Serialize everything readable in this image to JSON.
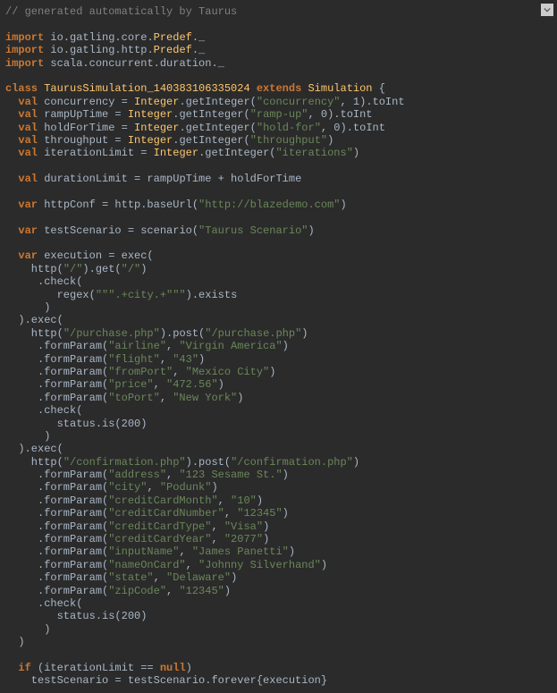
{
  "comment": "// generated automatically by Taurus",
  "kw": {
    "import": "import",
    "class": "class",
    "extends": "extends",
    "val": "val",
    "var": "var",
    "if": "if",
    "null": "null"
  },
  "imports": {
    "l1a": " io.gatling.core.",
    "l1b": "Predef",
    "l1c": "._",
    "l2a": " io.gatling.http.",
    "l2b": "Predef",
    "l2c": "._",
    "l3a": " scala.concurrent.duration._"
  },
  "classDecl": {
    "name": "TaurusSimulation_140383106335024",
    "base": "Simulation",
    "brace": " {"
  },
  "vals": {
    "concurrency_a": " concurrency = ",
    "concurrency_b": "Integer",
    "concurrency_c": ".getInteger(",
    "concurrency_d": "\"concurrency\"",
    "concurrency_e": ", 1).toInt",
    "rampUp_a": " rampUpTime = ",
    "rampUp_b": "Integer",
    "rampUp_c": ".getInteger(",
    "rampUp_d": "\"ramp-up\"",
    "rampUp_e": ", 0).toInt",
    "hold_a": " holdForTime = ",
    "hold_b": "Integer",
    "hold_c": ".getInteger(",
    "hold_d": "\"hold-for\"",
    "hold_e": ", 0).toInt",
    "thr_a": " throughput = ",
    "thr_b": "Integer",
    "thr_c": ".getInteger(",
    "thr_d": "\"throughput\"",
    "thr_e": ")",
    "iter_a": " iterationLimit = ",
    "iter_b": "Integer",
    "iter_c": ".getInteger(",
    "iter_d": "\"iterations\"",
    "iter_e": ")",
    "dur": " durationLimit = rampUpTime + holdForTime"
  },
  "httpConf": {
    "a": " httpConf = http.baseUrl(",
    "b": "\"http://blazedemo.com\"",
    "c": ")"
  },
  "scenario": {
    "a": " testScenario = scenario(",
    "b": "\"Taurus Scenario\"",
    "c": ")"
  },
  "exec": {
    "header": " execution = exec(",
    "http_a": "    http(",
    "slash1": "\"/\"",
    "get": ").get(",
    "slash2": "\"/\"",
    "close1": ")",
    "check": "     .check(",
    "regex_a": "        regex(",
    "regex_b": "\"\"\".+city.+\"\"\"",
    "regex_c": ").exists",
    "paren_close": "      )",
    "exec_chain": "  ).exec(",
    "purchase_a": "    http(",
    "purchase_b": "\"/purchase.php\"",
    "purchase_c": ").post(",
    "purchase_d": "\"/purchase.php\"",
    "purchase_e": ")",
    "fp_open": "     .formParam(",
    "airline_k": "\"airline\"",
    "airline_v": "\"Virgin America\"",
    "flight_k": "\"flight\"",
    "flight_v": "\"43\"",
    "fromPort_k": "\"fromPort\"",
    "fromPort_v": "\"Mexico City\"",
    "price_k": "\"price\"",
    "price_v": "\"472.56\"",
    "toPort_k": "\"toPort\"",
    "toPort_v": "\"New York\"",
    "status": "        status.is(200)",
    "confirm_a": "    http(",
    "confirm_b": "\"/confirmation.php\"",
    "confirm_c": ").post(",
    "confirm_d": "\"/confirmation.php\"",
    "confirm_e": ")",
    "address_k": "\"address\"",
    "address_v": "\"123 Sesame St.\"",
    "city_k": "\"city\"",
    "city_v": "\"Podunk\"",
    "ccMonth_k": "\"creditCardMonth\"",
    "ccMonth_v": "\"10\"",
    "ccNum_k": "\"creditCardNumber\"",
    "ccNum_v": "\"12345\"",
    "ccType_k": "\"creditCardType\"",
    "ccType_v": "\"Visa\"",
    "ccYear_k": "\"creditCardYear\"",
    "ccYear_v": "\"2077\"",
    "inputName_k": "\"inputName\"",
    "inputName_v": "\"James Panetti\"",
    "nameOnCard_k": "\"nameOnCard\"",
    "nameOnCard_v": "\"Johnny Silverhand\"",
    "state_k": "\"state\"",
    "state_v": "\"Delaware\"",
    "zip_k": "\"zipCode\"",
    "zip_v": "\"12345\"",
    "final_close": "  )",
    "comma_sep": ", ",
    "fp_close": ")"
  },
  "ifblock": {
    "cond_a": " (iterationLimit == ",
    "cond_b": ")",
    "body": "    testScenario = testScenario.forever{execution}"
  }
}
